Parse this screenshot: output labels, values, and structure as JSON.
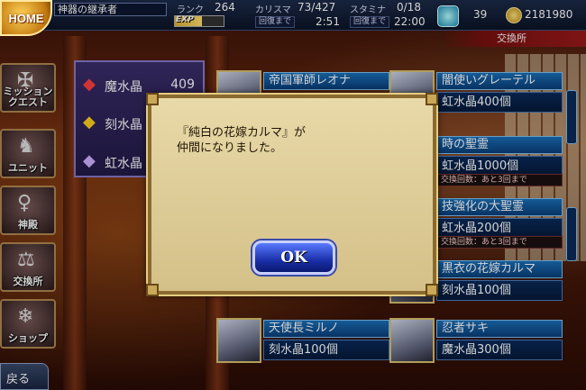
{
  "header": {
    "home_label": "HOME",
    "player_title": "神器の継承者",
    "rank_label": "ランク",
    "rank_value": "264",
    "exp_label": "EXP",
    "exp_fraction": 0.55,
    "charisma_label": "カリスマ",
    "charisma_value": "73/427",
    "charisma_recover_label": "回復まで",
    "charisma_recover_time": "2:51",
    "stamina_label": "スタミナ",
    "stamina_value": "0/18",
    "stamina_recover_label": "回復まで",
    "stamina_recover_time": "22:00",
    "crystals": "39",
    "gold": "2181980",
    "screen_label": "交換所"
  },
  "nav": [
    {
      "label": "ミッション\nクエスト",
      "icon": "sword-emblem-icon"
    },
    {
      "label": "ユニット",
      "icon": "knight-icon"
    },
    {
      "label": "神殿",
      "icon": "goddess-icon"
    },
    {
      "label": "交換所",
      "icon": "scales-icon"
    },
    {
      "label": "ショップ",
      "icon": "crystal-icon"
    }
  ],
  "back_label": "戻る",
  "currencies": [
    {
      "name": "魔水晶",
      "value": "409",
      "color": "#ff4040"
    },
    {
      "name": "刻水晶",
      "value": "",
      "color": "#ffd020"
    },
    {
      "name": "虹水晶",
      "value": "",
      "color": "#d0b0ff"
    }
  ],
  "cards_left": [
    {
      "name": "帝国軍師レオナ",
      "cost": ""
    },
    {
      "name": "天使長ミルノ",
      "cost": "刻水晶100個"
    }
  ],
  "cards_right": [
    {
      "name": "闇使いグレーテル",
      "cost": "虹水晶400個",
      "limit": ""
    },
    {
      "name": "時の聖霊",
      "cost": "虹水晶1000個",
      "limit": "交換回数：あと3回まで"
    },
    {
      "name": "技強化の大聖霊",
      "cost": "虹水晶200個",
      "limit": "交換回数：あと3回まで"
    },
    {
      "name": "黒衣の花嫁カルマ",
      "cost": "刻水晶100個",
      "limit": ""
    },
    {
      "name": "忍者サキ",
      "cost": "魔水晶300個",
      "limit": ""
    }
  ],
  "dialog": {
    "message": "『純白の花嫁カルマ』が\n仲間になりました。",
    "ok_label": "OK"
  }
}
